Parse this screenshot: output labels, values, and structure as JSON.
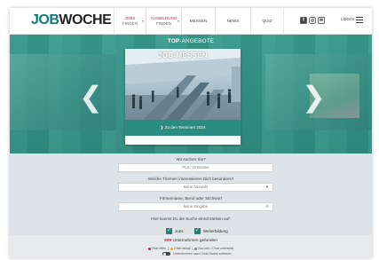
{
  "header": {
    "logo_job": "JOB",
    "logo_woche": "WOCHE",
    "nav": [
      {
        "line1": "JOBS",
        "line2": "FINDEN"
      },
      {
        "line1": "AUSBILDUNG",
        "line2": "FINDEN"
      },
      {
        "line1": "MESSEN"
      },
      {
        "line1": "NEWS"
      },
      {
        "line1": "QUIZ"
      }
    ],
    "login": "LOGIN"
  },
  "hero": {
    "title_bold": "TOP",
    "title_rest": "-ANGEBOTE",
    "card_title": "JOB-MESSEN",
    "card_link": "❯ Zu den Terminen 2024"
  },
  "search": {
    "q1_label": "Wo suchen Sie?",
    "q1_placeholder": "PLZ / Ortsname",
    "q2_label": "Welche Themen interessieren Dich besonders?",
    "q2_value": "keine Auswahl",
    "q3_label": "Firmenname, Beruf oder Stichwort",
    "q3_placeholder": "keine Eingabe",
    "q4_label": "Hier kannst Du die Suche einschränken auf:",
    "check_jobs": "Jobs",
    "check_weiterbildung": "Weiterbildung"
  },
  "results": {
    "count": "609",
    "count_text": "Unternehmen gefunden",
    "legend": [
      {
        "text": "Chat offen",
        "color": "#d41b3f"
      },
      {
        "text": "Chat belegt",
        "color": "#f0b400"
      },
      {
        "text": "Nur Info / Chat unbesetzt",
        "color": "#888888"
      }
    ],
    "toggle_text": "Unternehmen nach Chat-Status sortieren"
  }
}
